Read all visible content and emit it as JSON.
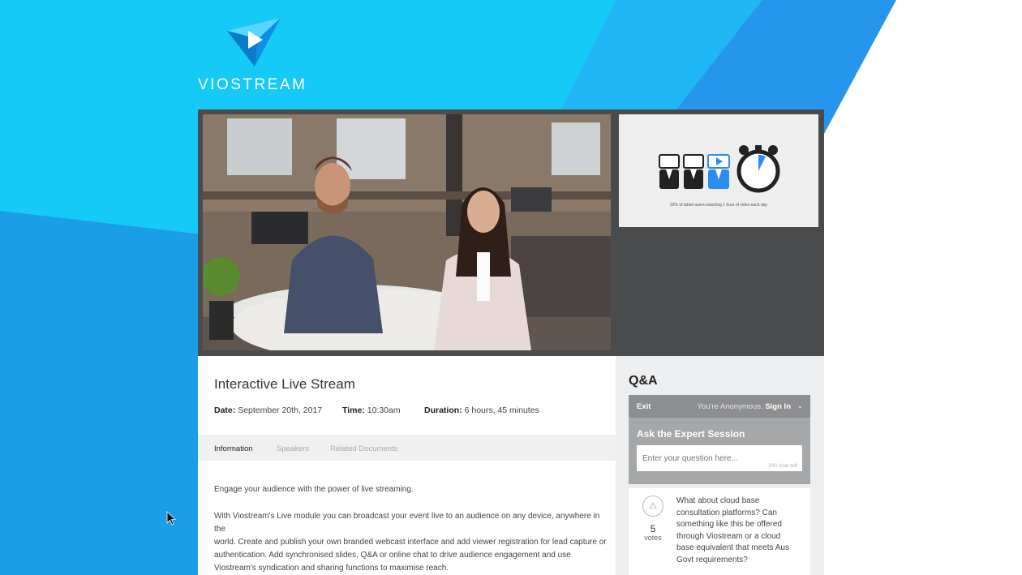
{
  "brand": {
    "name": "VIOSTREAM",
    "icon": "play-triangle-logo"
  },
  "slide": {
    "caption": "33% of tablet users watching 1 hour of video each day"
  },
  "event": {
    "title": "Interactive Live Stream",
    "date_label": "Date:",
    "date": "September 20th, 2017",
    "time_label": "Time:",
    "time": "10:30am",
    "duration_label": "Duration:",
    "duration": "6 hours, 45 minutes"
  },
  "tabs": [
    "Information",
    "Speakers",
    "Related Documents"
  ],
  "description": {
    "p1": "Engage your audience with the power of live streaming.",
    "p2_lines": [
      "With Viostream's Live module you can broadcast your event live to an audience on any device, anywhere in the",
      "world. Create and publish your own branded webcast interface and add viewer registration for lead capture or",
      "authentication. Add synchronised slides, Q&A or online chat to drive audience engagement and use",
      "Viostream's syndication and sharing functions to maximise reach."
    ]
  },
  "qa": {
    "heading": "Q&A",
    "exit": "Exit",
    "anonymous": "You're Anonymous.",
    "sign_in": "Sign In",
    "session_title": "Ask the Expert Session",
    "input_placeholder": "Enter your question here...",
    "chars_left": "200 char left",
    "question": {
      "votes": "5",
      "votes_label": "votes",
      "lines": [
        "What about cloud base",
        "consultation platforms? Can",
        "something like this be offered",
        "through Viostream or a cloud",
        "base equivalent that meets Aus",
        "Govt requirements?"
      ]
    }
  },
  "colors": {
    "accent": "#1ea6ef",
    "bar": "#8d8e90",
    "player_bg": "#4a4b4d"
  }
}
